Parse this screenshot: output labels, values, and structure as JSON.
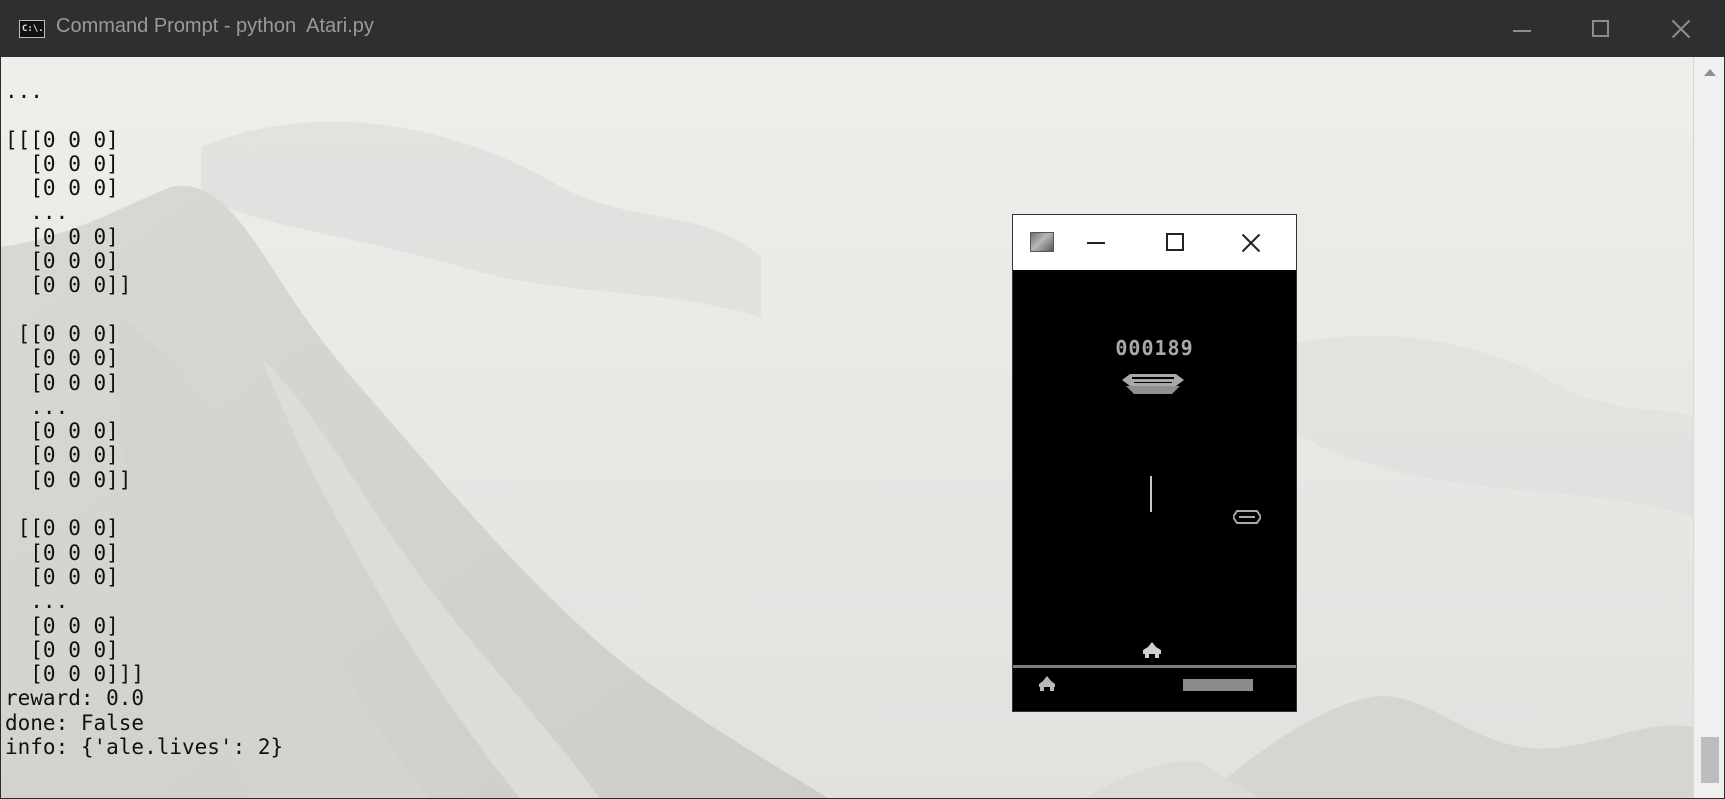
{
  "console": {
    "title": "Command Prompt - python  Atari.py",
    "icon_text": "C:\\.",
    "output": "...\n\n[[[0 0 0]\n  [0 0 0]\n  [0 0 0]\n  ...\n  [0 0 0]\n  [0 0 0]\n  [0 0 0]]\n\n [[0 0 0]\n  [0 0 0]\n  [0 0 0]\n  ...\n  [0 0 0]\n  [0 0 0]\n  [0 0 0]]\n\n [[0 0 0]\n  [0 0 0]\n  [0 0 0]\n  ...\n  [0 0 0]\n  [0 0 0]\n  [0 0 0]]]\nreward: 0.0\ndone: False\ninfo: {'ale.lives': 2}",
    "icons": {
      "app": "command-prompt-icon",
      "minimize": "minimize-icon",
      "maximize": "maximize-icon",
      "close": "close-icon"
    },
    "colors": {
      "titlebar": "#2f2f2f",
      "text": "#111111",
      "background": "#ecebe8"
    }
  },
  "game": {
    "score": "000189",
    "icons": {
      "app": "game-window-icon",
      "minimize": "minimize-icon",
      "maximize": "maximize-icon",
      "close": "close-icon"
    },
    "colors": {
      "screen": "#000000",
      "sprites": "#a9a9a9"
    }
  }
}
